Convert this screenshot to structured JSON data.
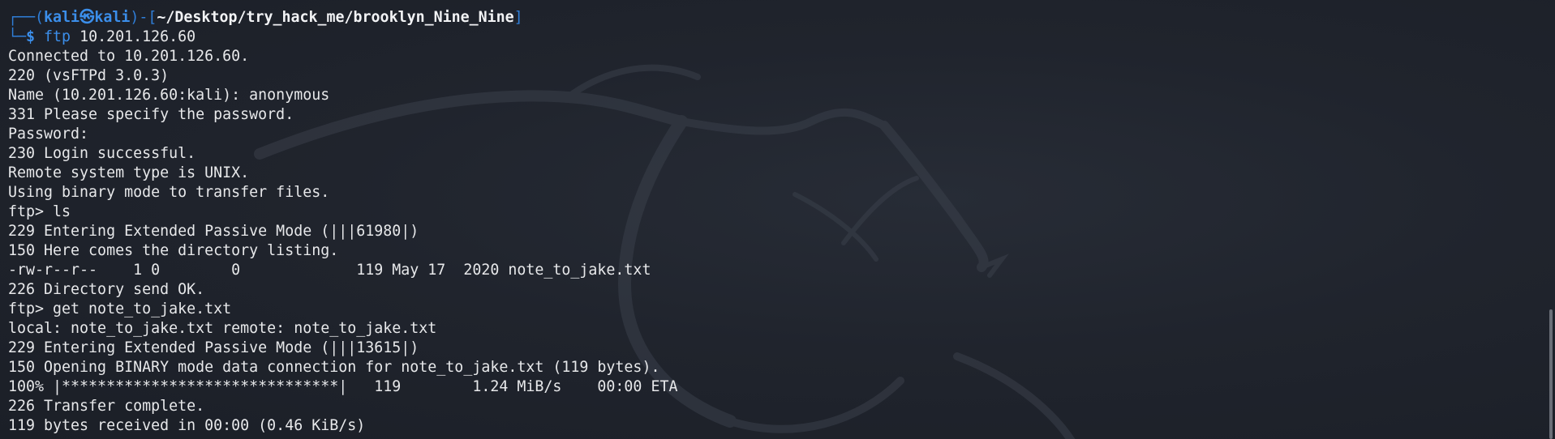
{
  "prompt": {
    "corner_top": "┌──(",
    "user": "kali",
    "skull": "㉿",
    "host": "kali",
    "close_paren": ")-[",
    "path": "~/Desktop/try_hack_me/brooklyn_Nine_Nine",
    "close_bracket": "]",
    "corner_bottom": "└─",
    "dollar": "$ ",
    "command": "ftp",
    "argument": " 10.201.126.60"
  },
  "output": [
    "Connected to 10.201.126.60.",
    "220 (vsFTPd 3.0.3)",
    "Name (10.201.126.60:kali): anonymous",
    "331 Please specify the password.",
    "Password:",
    "230 Login successful.",
    "Remote system type is UNIX.",
    "Using binary mode to transfer files.",
    "ftp> ls",
    "229 Entering Extended Passive Mode (|||61980|)",
    "150 Here comes the directory listing.",
    "-rw-r--r--    1 0        0             119 May 17  2020 note_to_jake.txt",
    "226 Directory send OK.",
    "ftp> get note_to_jake.txt",
    "local: note_to_jake.txt remote: note_to_jake.txt",
    "229 Entering Extended Passive Mode (|||13615|)",
    "150 Opening BINARY mode data connection for note_to_jake.txt (119 bytes).",
    "100% |*******************************|   119        1.24 MiB/s    00:00 ETA",
    "226 Transfer complete.",
    "119 bytes received in 00:00 (0.46 KiB/s)"
  ],
  "colors": {
    "background": "#1d212b",
    "prompt_blue": "#3b8eea",
    "text": "#e7e8ea"
  },
  "icons": {
    "background_logo": "kali-dragon-icon"
  }
}
